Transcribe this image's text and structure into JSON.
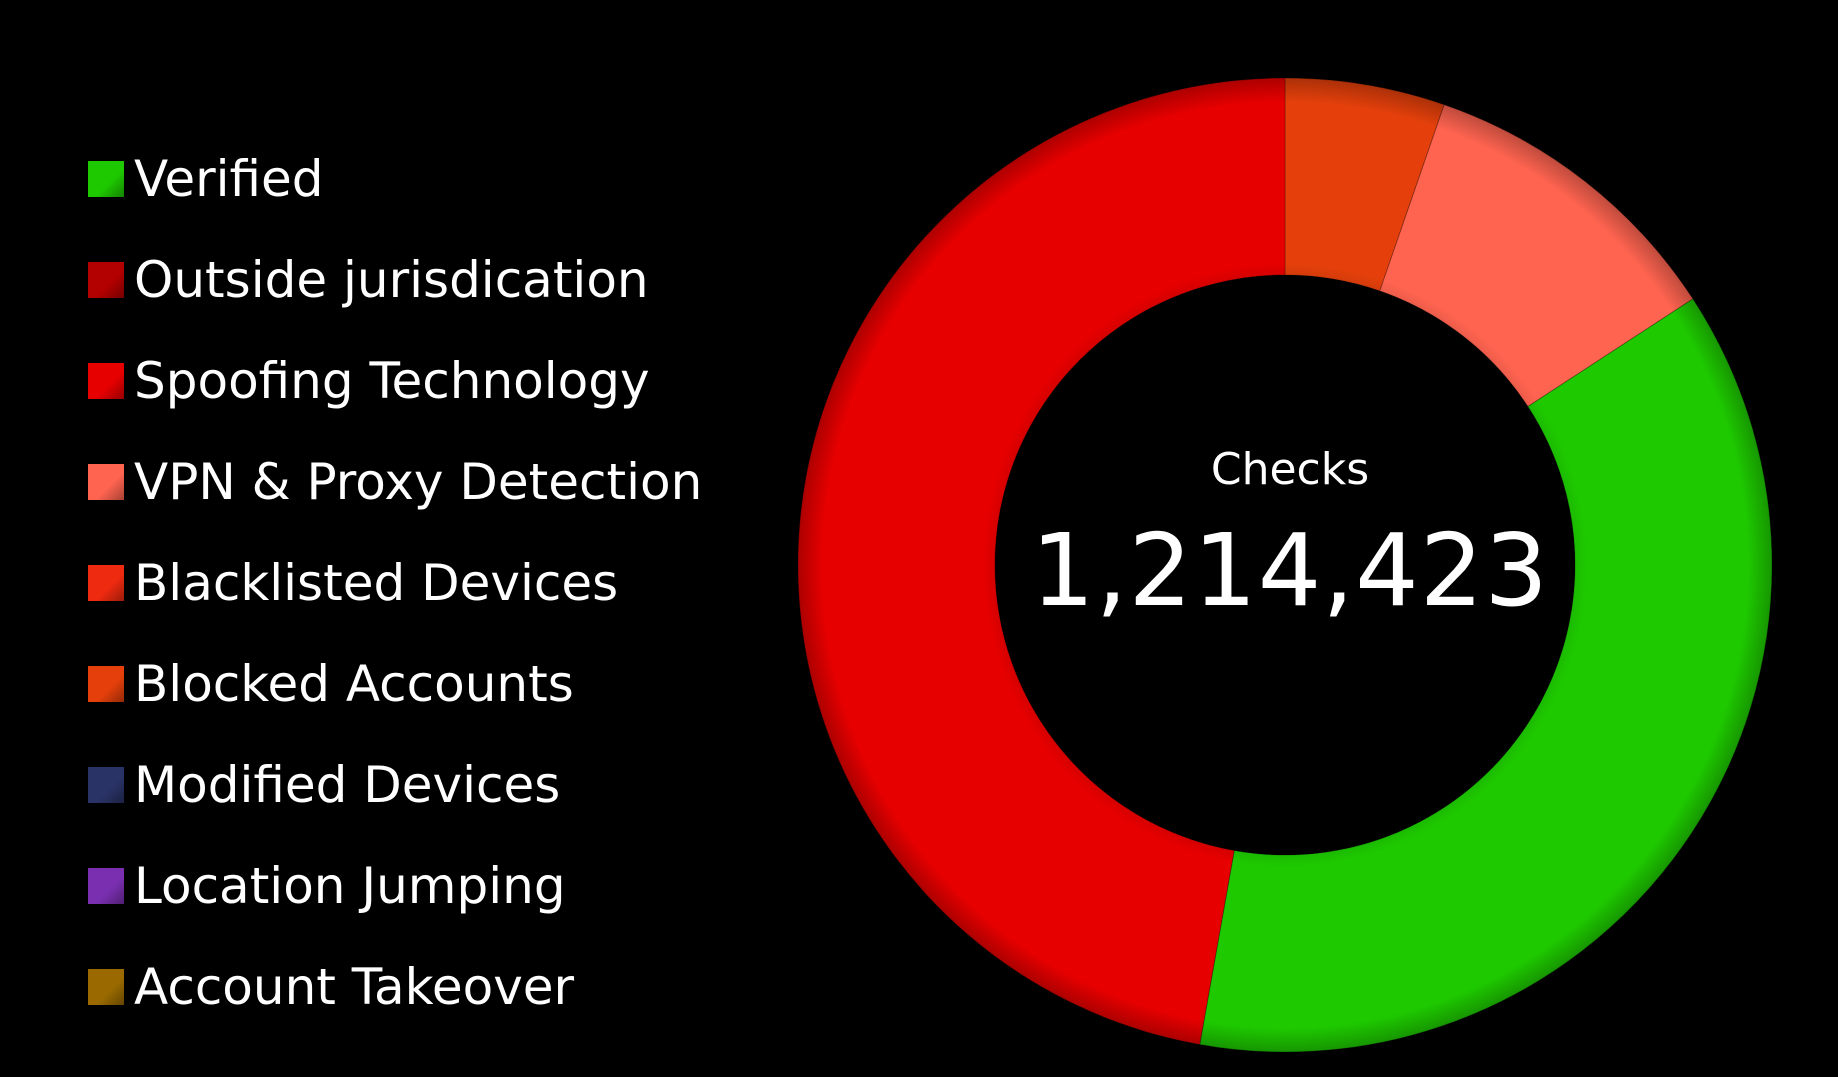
{
  "chart_data": {
    "type": "pie",
    "donut": true,
    "center_label": "Checks",
    "center_value": "1,214,423",
    "series": [
      {
        "name": "Verified",
        "value": 37.0,
        "color": "#1ec900"
      },
      {
        "name": "Outside jurisdication",
        "value": 0,
        "color": "#b30000"
      },
      {
        "name": "Spoofing Technology",
        "value": 52.5,
        "color": "#e60000"
      },
      {
        "name": "VPN & Proxy Detection",
        "value": 0,
        "color": "#ff6450"
      },
      {
        "name": "Blacklisted Devices",
        "value": 0,
        "color": "#ee2a10"
      },
      {
        "name": "Blocked Accounts",
        "value": 0,
        "color": "#e5400b"
      },
      {
        "name": "Modified Devices",
        "value": 0,
        "color": "#2a3366"
      },
      {
        "name": "Location Jumping",
        "value": 0,
        "color": "#7a2fb0"
      },
      {
        "name": "Account Takeover",
        "value": 0,
        "color": "#9a6a00"
      }
    ],
    "slices_clockwise_from_top": [
      {
        "name": "Blocked Accounts",
        "value": 5.3
      },
      {
        "name": "VPN & Proxy Detection",
        "value": 10.5
      },
      {
        "name": "Verified",
        "value": 37.0
      },
      {
        "name": "Spoofing Technology",
        "value": 47.2
      }
    ],
    "legend_placement": "left"
  }
}
